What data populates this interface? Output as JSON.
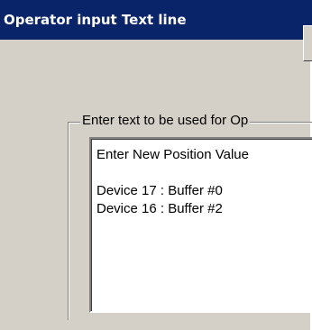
{
  "window": {
    "title": "Operator input Text line"
  },
  "group": {
    "label": "Enter text to be used for Op"
  },
  "textarea": {
    "line1": "Enter New Position Value",
    "line2": "Device 17 : Buffer #0",
    "line3": "Device 16 : Buffer #2"
  },
  "colors": {
    "titlebar": "#0a246a",
    "face": "#d4d0c8"
  }
}
